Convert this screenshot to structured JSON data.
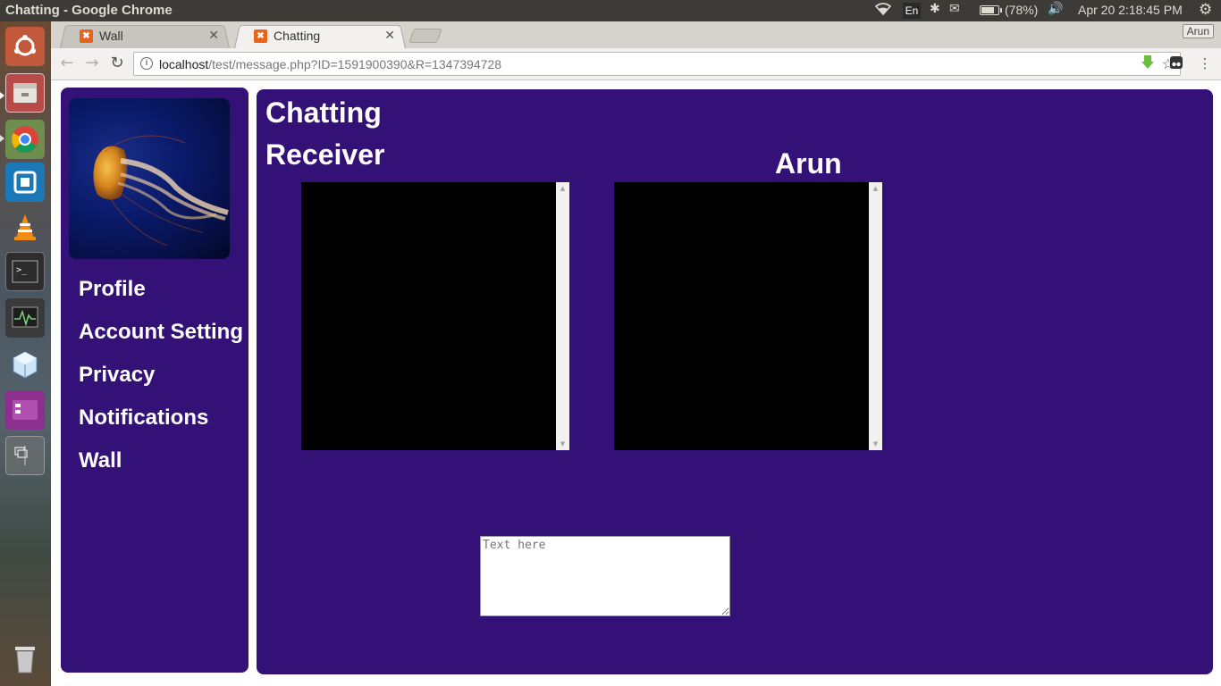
{
  "system": {
    "window_title": "Chatting - Google Chrome",
    "keyboard_layout": "En",
    "battery": "(78%)",
    "battery_level": 0.78,
    "datetime": "Apr 20  2:18:45 PM"
  },
  "launcher": {
    "items": [
      "ubuntu-dash",
      "files",
      "chrome",
      "remmina",
      "vlc",
      "terminal",
      "system-monitor",
      "virtualbox",
      "software",
      "workspaces",
      "trash"
    ]
  },
  "browser": {
    "tabs": [
      {
        "label": "Wall",
        "active": false
      },
      {
        "label": "Chatting",
        "active": true
      }
    ],
    "profile": "Arun",
    "url_host": "localhost",
    "url_path": "/test/message.php?ID=1591900390&R=1347394728"
  },
  "sidebar": {
    "nav": [
      {
        "label": "Profile"
      },
      {
        "label": "Account Setting"
      },
      {
        "label": "Privacy"
      },
      {
        "label": "Notifications"
      },
      {
        "label": "Wall"
      }
    ]
  },
  "main": {
    "title": "Chatting",
    "receiver_label": "Receiver",
    "receiver_name": "Arun",
    "input_placeholder": "Text here",
    "input_value": ""
  },
  "colors": {
    "panel_bg": "#331177",
    "chat_bg": "#000000"
  }
}
